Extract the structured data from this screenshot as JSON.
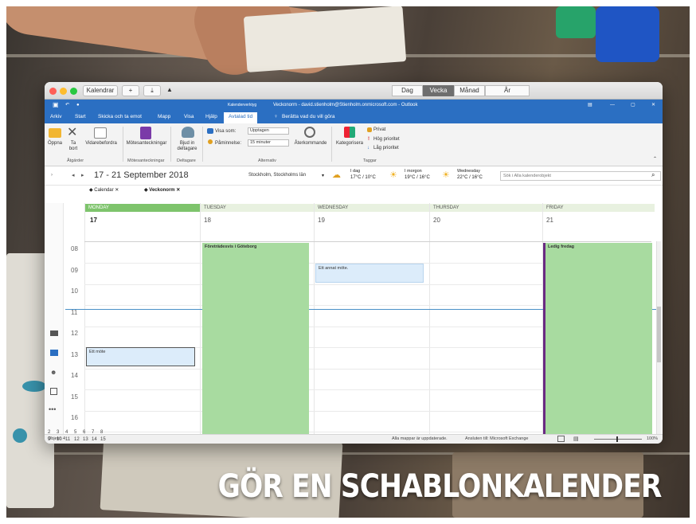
{
  "mac": {
    "tab_label": "Kalendrar",
    "views": [
      "Dag",
      "Vecka",
      "Månad",
      "År"
    ],
    "active_view": "Vecka"
  },
  "window": {
    "title": "Veckonorm - david.stienholm@Stienholm.onmicrosoft.com - Outlook",
    "context_tab": "Kalenderverktyg"
  },
  "menu": [
    "Arkiv",
    "Start",
    "Skicka och ta emot",
    "Mapp",
    "Visa",
    "Hjälp",
    "Avtalad tid"
  ],
  "menu_active": "Avtalad tid",
  "tell_me": "Berätta vad du vill göra",
  "ribbon": {
    "open": "Öppna",
    "delete": "Ta bort",
    "forward": "Vidarebefordra",
    "notes": "Mötesanteckningar",
    "invite": "Bjud in deltagare",
    "show_as_label": "Visa som:",
    "show_as_value": "Upptagen",
    "reminder_label": "Påminnelse:",
    "reminder_value": "15 minuter",
    "recurrence": "Återkommande",
    "categorize": "Kategorisera",
    "private": "Privat",
    "high": "Hög prioritet",
    "low": "Låg prioritet",
    "groups": [
      "Åtgärder",
      "Mötesanteckningar",
      "Deltagare",
      "Alternativ",
      "Taggar"
    ]
  },
  "nav": {
    "date_range": "17 - 21 September 2018",
    "location": "Stockholm, Stockholms län",
    "weather": [
      {
        "day": "I dag",
        "temp": "17°C / 10°C"
      },
      {
        "day": "I morgon",
        "temp": "19°C / 16°C"
      },
      {
        "day": "Wednesday",
        "temp": "22°C / 16°C"
      }
    ],
    "search_placeholder": "Sök i Alla kalenderobjekt"
  },
  "tabs": [
    "Calendar",
    "Veckonorm"
  ],
  "days": [
    {
      "name": "MONDAY",
      "num": "17"
    },
    {
      "name": "TUESDAY",
      "num": "18"
    },
    {
      "name": "WEDNESDAY",
      "num": "19"
    },
    {
      "name": "THURSDAY",
      "num": "20"
    },
    {
      "name": "FRIDAY",
      "num": "21"
    }
  ],
  "hours": [
    "08",
    "09",
    "10",
    "11",
    "12",
    "13",
    "14",
    "15",
    "16"
  ],
  "events": {
    "tuesday": "Företrädesvis i Göteborg",
    "wednesday": "Ett annat möte.",
    "monday": "Ett möte",
    "friday": "Ledig fredag"
  },
  "status": {
    "items": "Objekt: 4",
    "updated": "Alla mappar är uppdaterade.",
    "connected": "Ansluten till: Microsoft Exchange",
    "zoom": "100%"
  },
  "mini_cal": [
    [
      "2",
      "3",
      "4",
      "5",
      "6",
      "7",
      "8"
    ],
    [
      "9",
      "10",
      "11",
      "12",
      "13",
      "14",
      "15"
    ]
  ],
  "headline": "GÖR EN SCHABLONKALENDER",
  "colors": {
    "accent": "#2b6fc2",
    "event_green": "#a8dba0",
    "event_blue": "#dcecfa",
    "friday_bar": "#6a2a82"
  }
}
